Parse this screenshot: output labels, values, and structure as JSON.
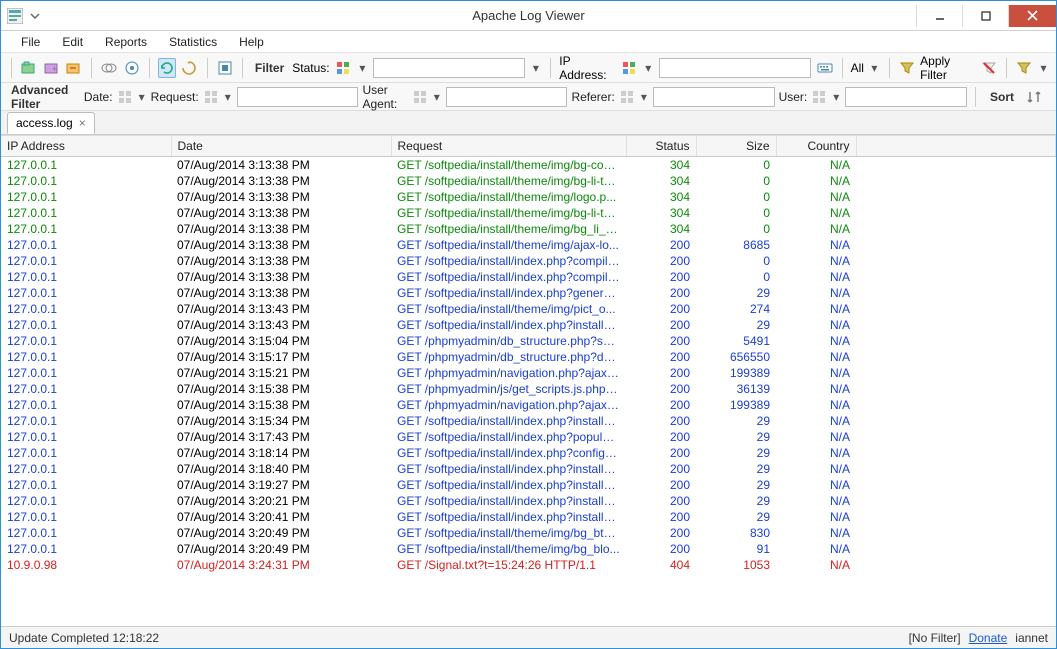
{
  "window": {
    "title": "Apache Log Viewer"
  },
  "menu": [
    "File",
    "Edit",
    "Reports",
    "Statistics",
    "Help"
  ],
  "toolbar": {
    "filter_label": "Filter",
    "status_label": "Status:",
    "ip_label": "IP Address:",
    "all_label": "All",
    "apply_label": "Apply Filter"
  },
  "advfilter": {
    "title": "Advanced Filter",
    "date_label": "Date:",
    "request_label": "Request:",
    "useragent_label": "User Agent:",
    "referer_label": "Referer:",
    "user_label": "User:",
    "sort_label": "Sort"
  },
  "tab": {
    "name": "access.log"
  },
  "columns": {
    "ip": "IP Address",
    "date": "Date",
    "request": "Request",
    "status": "Status",
    "size": "Size",
    "country": "Country"
  },
  "rows": [
    {
      "cls": "green",
      "ip": "127.0.0.1",
      "date": "07/Aug/2014 3:13:38 PM",
      "req": "GET /softpedia/install/theme/img/bg-con...",
      "status": "304",
      "size": "0",
      "country": "N/A"
    },
    {
      "cls": "green",
      "ip": "127.0.0.1",
      "date": "07/Aug/2014 3:13:38 PM",
      "req": "GET /softpedia/install/theme/img/bg-li-ta...",
      "status": "304",
      "size": "0",
      "country": "N/A"
    },
    {
      "cls": "green",
      "ip": "127.0.0.1",
      "date": "07/Aug/2014 3:13:38 PM",
      "req": "GET /softpedia/install/theme/img/logo.p...",
      "status": "304",
      "size": "0",
      "country": "N/A"
    },
    {
      "cls": "green",
      "ip": "127.0.0.1",
      "date": "07/Aug/2014 3:13:38 PM",
      "req": "GET /softpedia/install/theme/img/bg-li-ta...",
      "status": "304",
      "size": "0",
      "country": "N/A"
    },
    {
      "cls": "green",
      "ip": "127.0.0.1",
      "date": "07/Aug/2014 3:13:38 PM",
      "req": "GET /softpedia/install/theme/img/bg_li_s...",
      "status": "304",
      "size": "0",
      "country": "N/A"
    },
    {
      "cls": "blue",
      "ip": "127.0.0.1",
      "date": "07/Aug/2014 3:13:38 PM",
      "req": "GET /softpedia/install/theme/img/ajax-lo...",
      "status": "200",
      "size": "8685",
      "country": "N/A"
    },
    {
      "cls": "blue",
      "ip": "127.0.0.1",
      "date": "07/Aug/2014 3:13:38 PM",
      "req": "GET /softpedia/install/index.php?compile...",
      "status": "200",
      "size": "0",
      "country": "N/A"
    },
    {
      "cls": "blue",
      "ip": "127.0.0.1",
      "date": "07/Aug/2014 3:13:38 PM",
      "req": "GET /softpedia/install/index.php?compile...",
      "status": "200",
      "size": "0",
      "country": "N/A"
    },
    {
      "cls": "blue",
      "ip": "127.0.0.1",
      "date": "07/Aug/2014 3:13:38 PM",
      "req": "GET /softpedia/install/index.php?generat...",
      "status": "200",
      "size": "29",
      "country": "N/A"
    },
    {
      "cls": "blue",
      "ip": "127.0.0.1",
      "date": "07/Aug/2014 3:13:43 PM",
      "req": "GET /softpedia/install/theme/img/pict_o...",
      "status": "200",
      "size": "274",
      "country": "N/A"
    },
    {
      "cls": "blue",
      "ip": "127.0.0.1",
      "date": "07/Aug/2014 3:13:43 PM",
      "req": "GET /softpedia/install/index.php?installD...",
      "status": "200",
      "size": "29",
      "country": "N/A"
    },
    {
      "cls": "blue",
      "ip": "127.0.0.1",
      "date": "07/Aug/2014 3:15:04 PM",
      "req": "GET /phpmyadmin/db_structure.php?ser...",
      "status": "200",
      "size": "5491",
      "country": "N/A"
    },
    {
      "cls": "blue",
      "ip": "127.0.0.1",
      "date": "07/Aug/2014 3:15:17 PM",
      "req": "GET /phpmyadmin/db_structure.php?db=...",
      "status": "200",
      "size": "656550",
      "country": "N/A"
    },
    {
      "cls": "blue",
      "ip": "127.0.0.1",
      "date": "07/Aug/2014 3:15:21 PM",
      "req": "GET /phpmyadmin/navigation.php?ajax_r...",
      "status": "200",
      "size": "199389",
      "country": "N/A"
    },
    {
      "cls": "blue",
      "ip": "127.0.0.1",
      "date": "07/Aug/2014 3:15:38 PM",
      "req": "GET /phpmyadmin/js/get_scripts.js.php?...",
      "status": "200",
      "size": "36139",
      "country": "N/A"
    },
    {
      "cls": "blue",
      "ip": "127.0.0.1",
      "date": "07/Aug/2014 3:15:38 PM",
      "req": "GET /phpmyadmin/navigation.php?ajax_r...",
      "status": "200",
      "size": "199389",
      "country": "N/A"
    },
    {
      "cls": "blue",
      "ip": "127.0.0.1",
      "date": "07/Aug/2014 3:15:34 PM",
      "req": "GET /softpedia/install/index.php?installD...",
      "status": "200",
      "size": "29",
      "country": "N/A"
    },
    {
      "cls": "blue",
      "ip": "127.0.0.1",
      "date": "07/Aug/2014 3:17:43 PM",
      "req": "GET /softpedia/install/index.php?populat...",
      "status": "200",
      "size": "29",
      "country": "N/A"
    },
    {
      "cls": "blue",
      "ip": "127.0.0.1",
      "date": "07/Aug/2014 3:18:14 PM",
      "req": "GET /softpedia/install/index.php?configu...",
      "status": "200",
      "size": "29",
      "country": "N/A"
    },
    {
      "cls": "blue",
      "ip": "127.0.0.1",
      "date": "07/Aug/2014 3:18:40 PM",
      "req": "GET /softpedia/install/index.php?installFi...",
      "status": "200",
      "size": "29",
      "country": "N/A"
    },
    {
      "cls": "blue",
      "ip": "127.0.0.1",
      "date": "07/Aug/2014 3:19:27 PM",
      "req": "GET /softpedia/install/index.php?installM...",
      "status": "200",
      "size": "29",
      "country": "N/A"
    },
    {
      "cls": "blue",
      "ip": "127.0.0.1",
      "date": "07/Aug/2014 3:20:21 PM",
      "req": "GET /softpedia/install/index.php?installM...",
      "status": "200",
      "size": "29",
      "country": "N/A"
    },
    {
      "cls": "blue",
      "ip": "127.0.0.1",
      "date": "07/Aug/2014 3:20:41 PM",
      "req": "GET /softpedia/install/index.php?installM...",
      "status": "200",
      "size": "29",
      "country": "N/A"
    },
    {
      "cls": "blue",
      "ip": "127.0.0.1",
      "date": "07/Aug/2014 3:20:49 PM",
      "req": "GET /softpedia/install/theme/img/bg_bt_T...",
      "status": "200",
      "size": "830",
      "country": "N/A"
    },
    {
      "cls": "blue",
      "ip": "127.0.0.1",
      "date": "07/Aug/2014 3:20:49 PM",
      "req": "GET /softpedia/install/theme/img/bg_blo...",
      "status": "200",
      "size": "91",
      "country": "N/A"
    },
    {
      "cls": "red",
      "ip": "10.9.0.98",
      "date": "07/Aug/2014 3:24:31 PM",
      "req": "GET /Signal.txt?t=15:24:26 HTTP/1.1",
      "status": "404",
      "size": "1053",
      "country": "N/A"
    }
  ],
  "status": {
    "left": "Update Completed 12:18:22",
    "filter": "[No Filter]",
    "donate": "Donate",
    "brand": "iannet"
  }
}
